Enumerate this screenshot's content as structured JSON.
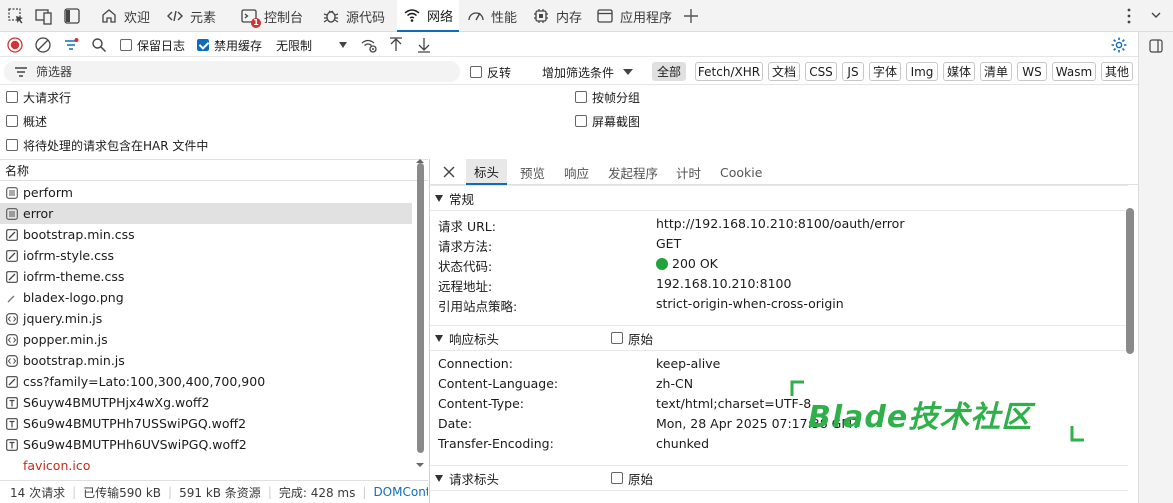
{
  "tabs": [
    {
      "label": "欢迎",
      "icon": "home-icon"
    },
    {
      "label": "元素",
      "icon": "code-icon"
    },
    {
      "label": "控制台",
      "icon": "console-icon",
      "badge": "1"
    },
    {
      "label": "源代码",
      "icon": "bug-icon"
    },
    {
      "label": "网络",
      "icon": "wifi-icon"
    },
    {
      "label": "性能",
      "icon": "performance-icon"
    },
    {
      "label": "内存",
      "icon": "memory-icon"
    },
    {
      "label": "应用程序",
      "icon": "application-icon"
    }
  ],
  "toolbar": {
    "preserve_log": "保留日志",
    "disable_cache": "禁用缓存",
    "throttling": "无限制"
  },
  "filter": {
    "placeholder": "筛选器",
    "invert": "反转",
    "more_filters": "增加筛选条件",
    "types": [
      "全部",
      "Fetch/XHR",
      "文档",
      "CSS",
      "JS",
      "字体",
      "Img",
      "媒体",
      "清单",
      "WS",
      "Wasm",
      "其他"
    ]
  },
  "options": {
    "big_rows": "大请求行",
    "overview": "概述",
    "har": "将待处理的请求包含在HAR 文件中",
    "group_by_frame": "按帧分组",
    "screenshots": "屏幕截图"
  },
  "list": {
    "header": "名称",
    "rows": [
      {
        "name": "perform",
        "icon": "document-icon"
      },
      {
        "name": "error",
        "icon": "document-icon"
      },
      {
        "name": "bootstrap.min.css",
        "icon": "stylesheet-icon"
      },
      {
        "name": "iofrm-style.css",
        "icon": "stylesheet-icon"
      },
      {
        "name": "iofrm-theme.css",
        "icon": "stylesheet-icon"
      },
      {
        "name": "bladex-logo.png",
        "icon": "image-icon"
      },
      {
        "name": "jquery.min.js",
        "icon": "script-icon"
      },
      {
        "name": "popper.min.js",
        "icon": "script-icon"
      },
      {
        "name": "bootstrap.min.js",
        "icon": "script-icon"
      },
      {
        "name": "css?family=Lato:100,300,400,700,900",
        "icon": "stylesheet-icon"
      },
      {
        "name": "S6uyw4BMUTPHjx4wXg.woff2",
        "icon": "font-icon"
      },
      {
        "name": "S6u9w4BMUTPHh7USSwiPGQ.woff2",
        "icon": "font-icon"
      },
      {
        "name": "S6u9w4BMUTPHh6UVSwiPGQ.woff2",
        "icon": "font-icon"
      },
      {
        "name": "favicon.ico",
        "icon": "none"
      }
    ]
  },
  "status": {
    "requests": "14 次请求",
    "transferred": "已传输590 kB",
    "resources": "591 kB 条资源",
    "finish": "完成: 428 ms",
    "dcl": "DOMContentLoa"
  },
  "detail_tabs": [
    "标头",
    "预览",
    "响应",
    "发起程序",
    "计时",
    "Cookie"
  ],
  "general": {
    "title": "常规",
    "rows": [
      {
        "k": "请求 URL:",
        "v": "http://192.168.10.210:8100/oauth/error"
      },
      {
        "k": "请求方法:",
        "v": "GET"
      },
      {
        "k": "状态代码:",
        "v": "200 OK"
      },
      {
        "k": "远程地址:",
        "v": "192.168.10.210:8100"
      },
      {
        "k": "引用站点策略:",
        "v": "strict-origin-when-cross-origin"
      }
    ]
  },
  "response_headers": {
    "title": "响应标头",
    "raw": "原始",
    "rows": [
      {
        "k": "Connection:",
        "v": "keep-alive"
      },
      {
        "k": "Content-Language:",
        "v": "zh-CN"
      },
      {
        "k": "Content-Type:",
        "v": "text/html;charset=UTF-8"
      },
      {
        "k": "Date:",
        "v": "Mon, 28 Apr 2025 07:17:38 GMT"
      },
      {
        "k": "Transfer-Encoding:",
        "v": "chunked"
      }
    ]
  },
  "request_headers": {
    "title": "请求标头",
    "raw": "原始"
  },
  "watermark": "Blade技术社区",
  "colors": {
    "accent": "#0f6cbd",
    "record": "#d13438",
    "status_ok": "#1fa33a",
    "watermark": "#2fb04a"
  }
}
